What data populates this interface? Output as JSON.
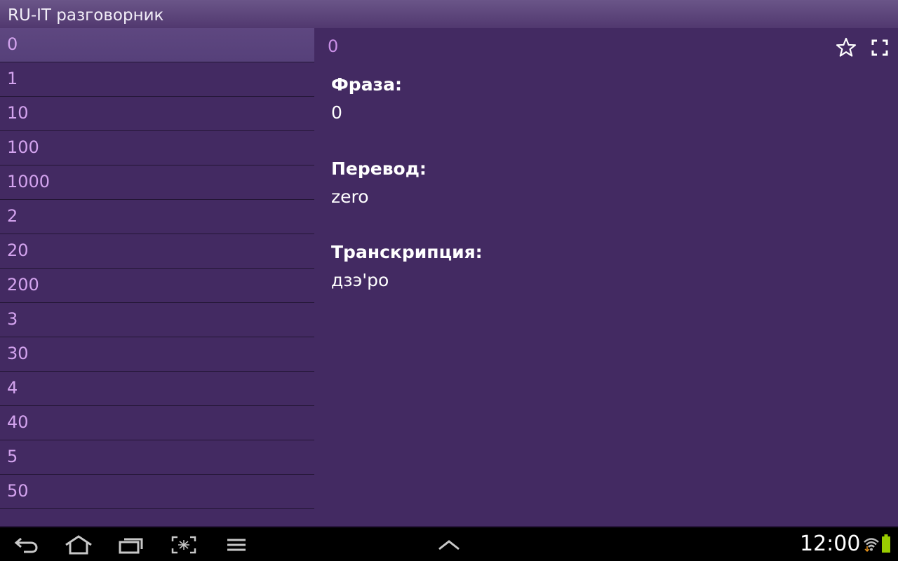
{
  "app": {
    "title": "RU-IT разговорник"
  },
  "list": {
    "items": [
      "0",
      "1",
      "10",
      "100",
      "1000",
      "2",
      "20",
      "200",
      "3",
      "30",
      "4",
      "40",
      "5",
      "50"
    ],
    "selected": "0"
  },
  "detail": {
    "header": "0",
    "phrase_label": "Фраза:",
    "phrase_value": "0",
    "translation_label": "Перевод:",
    "translation_value": "zero",
    "transcription_label": "Транскрипция:",
    "transcription_value": "дзэ'ро"
  },
  "statusbar": {
    "time": "12:00"
  },
  "icons": {
    "favorite": "star-outline-icon",
    "fullscreen": "fullscreen-icon",
    "back": "back-icon",
    "home": "home-icon",
    "recents": "recent-apps-icon",
    "screenshot": "screenshot-icon",
    "menu": "menu-icon",
    "up": "chevron-up-icon",
    "wifi": "wifi-icon",
    "battery": "battery-icon"
  },
  "colors": {
    "background": "#432a62",
    "titlebar": "#5f4a7f",
    "list_text": "#d3a3ee",
    "selected_item": "#5a4480",
    "battery": "#99cc00"
  }
}
